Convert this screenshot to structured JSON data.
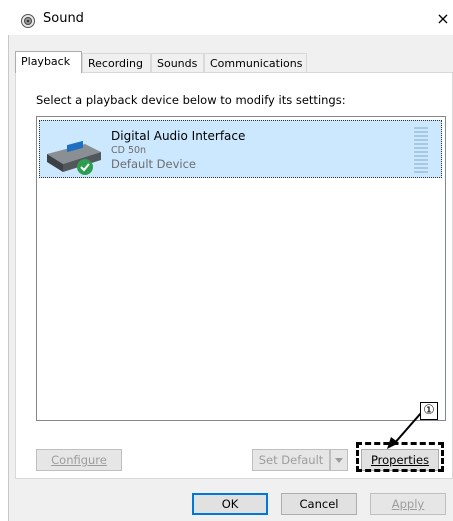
{
  "window": {
    "title": "Sound",
    "close_glyph": "×"
  },
  "tabs": [
    {
      "label": "Playback",
      "active": true
    },
    {
      "label": "Recording",
      "active": false
    },
    {
      "label": "Sounds",
      "active": false
    },
    {
      "label": "Communications",
      "active": false
    }
  ],
  "instruction": "Select a playback device below to modify its settings:",
  "devices": [
    {
      "name": "Digital Audio Interface",
      "model": "CD 50n",
      "status": "Default Device",
      "icon": "audio-device-icon",
      "default_badge": "green-check-icon"
    }
  ],
  "buttons": {
    "configure": "Configure",
    "set_default": "Set Default",
    "properties": "Properties",
    "ok": "OK",
    "cancel": "Cancel",
    "apply": "Apply"
  },
  "callout": {
    "number": "①"
  },
  "colors": {
    "selection": "#cce8ff",
    "check": "#2d9e4f",
    "button": "#e1e1e1"
  }
}
